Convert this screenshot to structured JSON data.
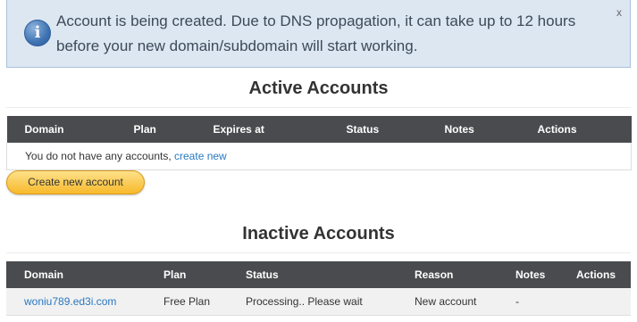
{
  "notice": {
    "message": "Account is being created. Due to DNS propagation, it can take up to 12 hours before your new domain/subdomain will start working.",
    "close_label": "x",
    "icon": "info-icon"
  },
  "active": {
    "title": "Active Accounts",
    "columns": [
      "Domain",
      "Plan",
      "Expires at",
      "Status",
      "Notes",
      "Actions"
    ],
    "empty_text": "You do not have any accounts, ",
    "empty_link": "create new",
    "create_button": "Create new account"
  },
  "inactive": {
    "title": "Inactive Accounts",
    "columns": [
      "Domain",
      "Plan",
      "Status",
      "Reason",
      "Notes",
      "Actions"
    ],
    "rows": [
      {
        "domain": "woniu789.ed3i.com",
        "plan": "Free Plan",
        "status": "Processing.. Please wait",
        "reason": "New account",
        "notes": "-",
        "actions": ""
      }
    ]
  },
  "colors": {
    "header_bg": "#4a4b4e",
    "notice_bg": "#dce7f2",
    "link": "#2a78c1",
    "button": "#f8b92b"
  }
}
